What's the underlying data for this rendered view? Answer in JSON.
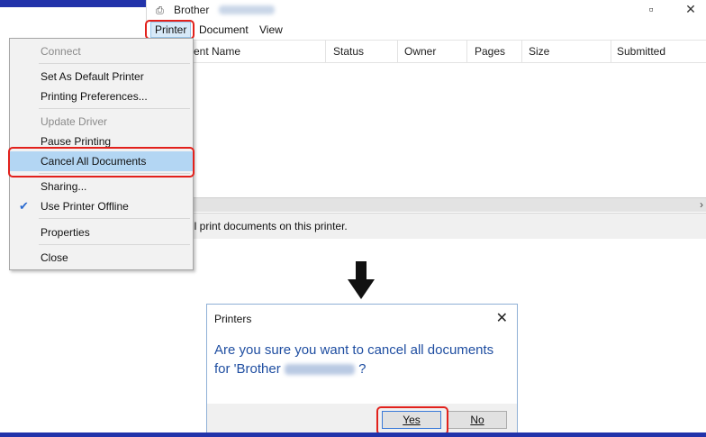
{
  "window": {
    "title": "Brother",
    "menubar": [
      "Printer",
      "Document",
      "View"
    ],
    "columns": [
      "ent Name",
      "Status",
      "Owner",
      "Pages",
      "Size",
      "Submitted"
    ],
    "status_text": "ll print documents on this printer."
  },
  "printer_menu": {
    "items": [
      {
        "label": "Connect",
        "disabled": true
      },
      {
        "label": "Set As Default Printer"
      },
      {
        "label": "Printing Preferences..."
      },
      {
        "label": "Update Driver",
        "disabled": true
      },
      {
        "label": "Pause Printing"
      },
      {
        "label": "Cancel All Documents",
        "highlighted": true
      },
      {
        "label": "Sharing..."
      },
      {
        "label": "Use Printer Offline",
        "checked": true
      },
      {
        "label": "Properties"
      },
      {
        "label": "Close"
      }
    ]
  },
  "dialog": {
    "title": "Printers",
    "message_line1": "Are you sure you want to cancel all documents",
    "message_line2_prefix": "for 'Brother",
    "message_line2_suffix": "?",
    "yes_label": "Yes",
    "no_label": "No"
  },
  "colors": {
    "highlight_box": "#e2211c",
    "message_text": "#1f4ea1",
    "menu_highlight": "#b3d6f3",
    "accent_bar": "#2233aa"
  },
  "icons": {
    "checkmark": "check-icon",
    "close": "close-icon",
    "arrow": "arrow-down-icon"
  }
}
